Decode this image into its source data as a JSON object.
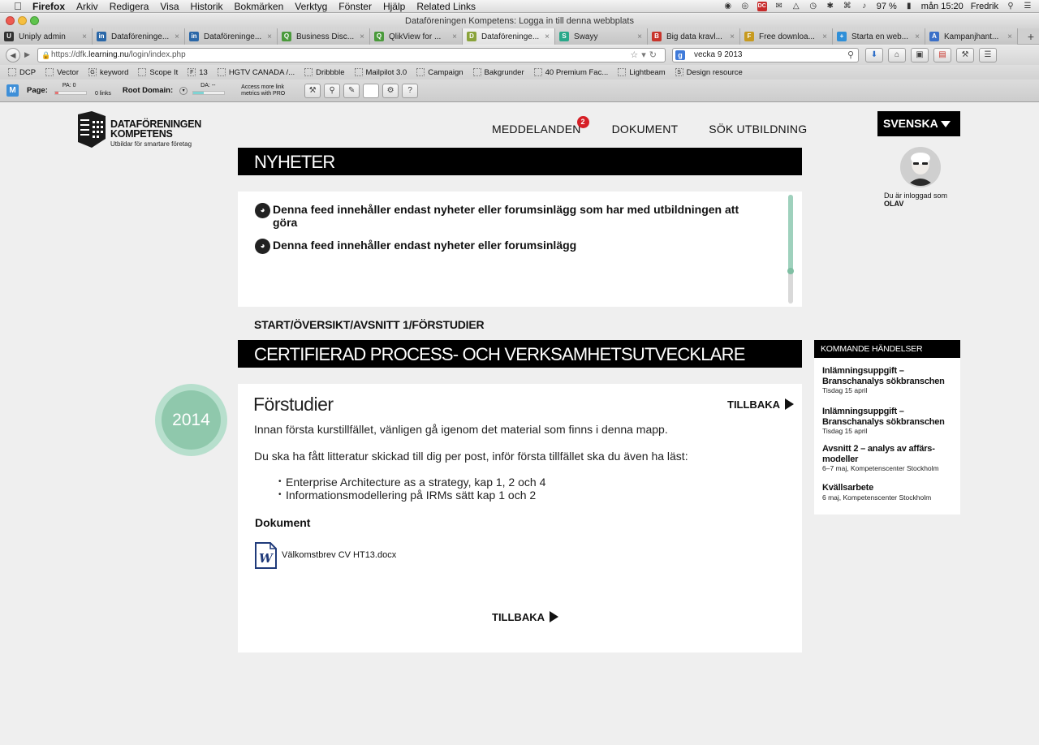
{
  "menubar": {
    "app": "Firefox",
    "items": [
      "Arkiv",
      "Redigera",
      "Visa",
      "Historik",
      "Bokmärken",
      "Verktyg",
      "Fönster",
      "Hjälp",
      "Related Links"
    ],
    "battery": "97 %",
    "clock": "mån 15:20",
    "user": "Fredrik"
  },
  "window": {
    "title": "Dataföreningen Kompetens: Logga in till denna webbplats"
  },
  "tabs": [
    {
      "label": "Uniply admin",
      "color": "#333333",
      "glyph": "U"
    },
    {
      "label": "Dataföreninge...",
      "color": "#2a67a8",
      "glyph": "in"
    },
    {
      "label": "Dataföreninge...",
      "color": "#2a67a8",
      "glyph": "in"
    },
    {
      "label": "Business Disc...",
      "color": "#4a9a3b",
      "glyph": "Q"
    },
    {
      "label": "QlikView for ...",
      "color": "#4a9a3b",
      "glyph": "Q"
    },
    {
      "label": "Dataföreninge...",
      "color": "#8aa33a",
      "glyph": "D",
      "active": true
    },
    {
      "label": "Swayy",
      "color": "#2aa88a",
      "glyph": "S"
    },
    {
      "label": "Big data kravl...",
      "color": "#c8342b",
      "glyph": "B"
    },
    {
      "label": "Free downloa...",
      "color": "#c79a1f",
      "glyph": "F"
    },
    {
      "label": "Starta en web...",
      "color": "#2f8fd8",
      "glyph": "+"
    },
    {
      "label": "Kampanjhant...",
      "color": "#3a6fc8",
      "glyph": "A"
    }
  ],
  "nav": {
    "url_prefix": "https://dfk.",
    "url_host": "learning.nu",
    "url_path": "/login/index.php",
    "search_value": "vecka 9 2013"
  },
  "bookmarks": [
    "DCP",
    "Vector",
    "keyword",
    "Scope It",
    "13",
    "HGTV CANADA /...",
    "Dribbble",
    "Mailpilot 3.0",
    "Campaign",
    "Bakgrunder",
    "40 Premium Fac...",
    "Lightbeam",
    "Design resource"
  ],
  "seo": {
    "page_label": "Page:",
    "pa_label": "PA: 0",
    "links": "0 links",
    "root_label": "Root Domain:",
    "da_label": "DA: --",
    "note": "Access more link metrics with PRO",
    "pa_fill": 0.1,
    "da_fill": 0.35
  },
  "site": {
    "logo_line1": "DATAFÖRENINGEN",
    "logo_line2": "KOMPETENS",
    "logo_tagline": "Utbildar för smartare företag",
    "nav": {
      "messages": "MEDDELANDEN",
      "messages_count": "2",
      "documents": "DOKUMENT",
      "search": "SÖK UTBILDNING"
    },
    "language": "SVENSKA",
    "logged_in_text": "Du är inloggad som",
    "user_name": "OLAV"
  },
  "news": {
    "heading": "NYHETER",
    "items": [
      "Denna feed innehåller endast nyheter eller forumsinlägg som har med utbildningen att göra",
      "Denna feed innehåller endast nyheter eller forumsinlägg"
    ],
    "scroll_position": 0.7
  },
  "breadcrumb": "START/ÖVERSIKT/AVSNITT 1/FÖRSTUDIER",
  "course": {
    "heading": "CERTIFIERAD PROCESS- OCH VERKSAMHETSUTVECKLARE",
    "year": "2014",
    "title": "Förstudier",
    "back": "TILLBAKA",
    "intro": "Innan första kurstillfället, vänligen gå igenom det material som finns i denna mapp.",
    "literature": "Du ska ha fått litteratur skickad till dig per post, inför första tillfället ska du även ha läst:",
    "books": [
      "Enterprise Architecture as a strategy, kap 1, 2 och 4",
      "Informationsmodellering på IRMs sätt kap 1 och 2"
    ],
    "documents_heading": "Dokument",
    "document_name": "Välkomstbrev CV HT13.docx"
  },
  "events": {
    "heading": "KOMMANDE HÄNDELSER",
    "items": [
      {
        "title": "Inlämningsuppgift – Branschanalys sökbranschen",
        "date": "Tisdag 15 april"
      },
      {
        "title": "Inlämningsuppgift – Branschanalys sökbranschen",
        "date": "Tisdag 15 april"
      },
      {
        "title": "Avsnitt 2 – analys av affärs-modeller",
        "date": "6–7 maj, Kompetenscenter Stockholm"
      },
      {
        "title": "Kvällsarbete",
        "date": "6 maj, Kompetenscenter Stockholm"
      }
    ]
  },
  "colors": {
    "accent_green": "#8fc8ac",
    "badge_red": "#d61f26",
    "header_black": "#000000"
  }
}
